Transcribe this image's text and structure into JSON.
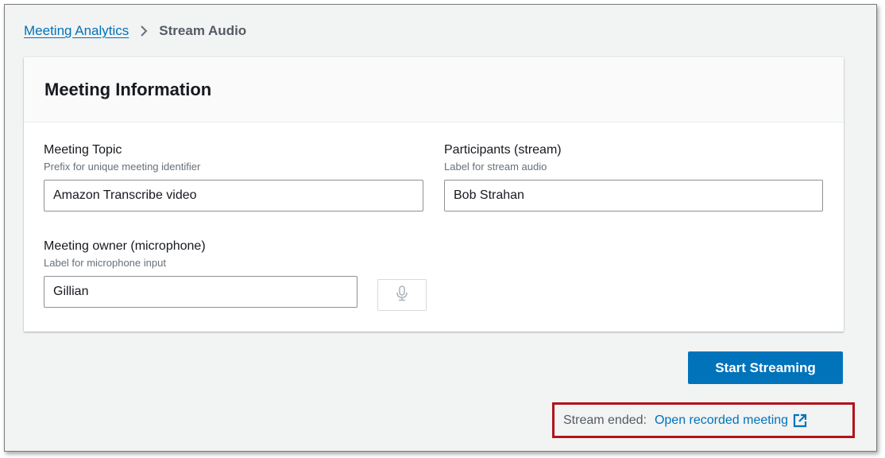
{
  "breadcrumb": {
    "parent_label": "Meeting Analytics",
    "current_label": "Stream Audio"
  },
  "panel": {
    "title": "Meeting Information",
    "fields": {
      "topic": {
        "label": "Meeting Topic",
        "description": "Prefix for unique meeting identifier",
        "value": "Amazon Transcribe video"
      },
      "participants": {
        "label": "Participants (stream)",
        "description": "Label for stream audio",
        "value": "Bob Strahan"
      },
      "owner": {
        "label": "Meeting owner (microphone)",
        "description": "Label for microphone input",
        "value": "Gillian"
      }
    },
    "mic_button_icon": "microphone-icon"
  },
  "actions": {
    "start_label": "Start Streaming"
  },
  "status": {
    "label": "Stream ended:",
    "link_label": "Open recorded meeting",
    "link_icon": "external-link-icon"
  },
  "colors": {
    "accent": "#0073bb",
    "highlight_border": "#b0141c"
  }
}
